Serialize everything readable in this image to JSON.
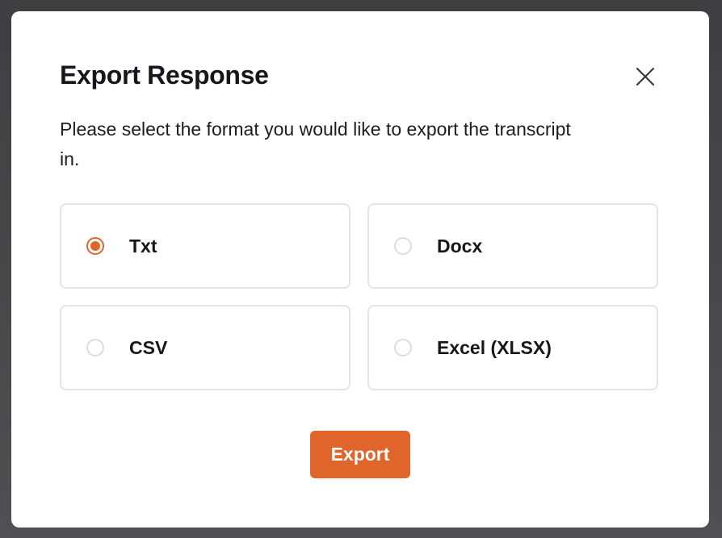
{
  "dialog": {
    "title": "Export Response",
    "description": "Please select the format you would like to export the transcript in.",
    "close_icon": "close-icon",
    "options": [
      {
        "label": "Txt",
        "selected": true
      },
      {
        "label": "Docx",
        "selected": false
      },
      {
        "label": "CSV",
        "selected": false
      },
      {
        "label": "Excel (XLSX)",
        "selected": false
      }
    ],
    "export_label": "Export"
  },
  "colors": {
    "accent": "#e0652b",
    "border": "#e3e4ea",
    "text": "#16161d",
    "backdrop": "#4a4a4c"
  }
}
